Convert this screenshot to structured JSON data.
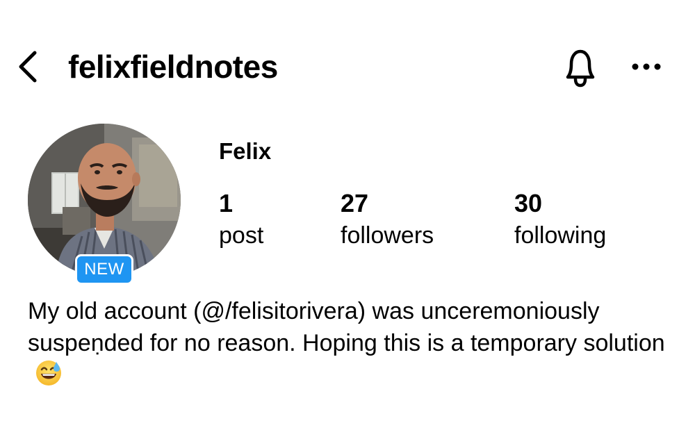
{
  "header": {
    "username": "felixfieldnotes",
    "back_icon": "chevron-left-icon",
    "bell_icon": "bell-icon",
    "more_icon": "ellipsis-icon"
  },
  "profile": {
    "display_name": "Felix",
    "badge": "NEW",
    "badge_color": "#1f95f2",
    "stats": [
      {
        "count": "1",
        "label": "post"
      },
      {
        "count": "27",
        "label": "followers"
      },
      {
        "count": "30",
        "label": "following"
      }
    ],
    "bio": "My old account (@/felisitorivera) was unceremoniously suspeṇded for no reason. Hoping this is a temporary solution",
    "bio_emoji": "grinning-face-with-sweat-icon"
  }
}
